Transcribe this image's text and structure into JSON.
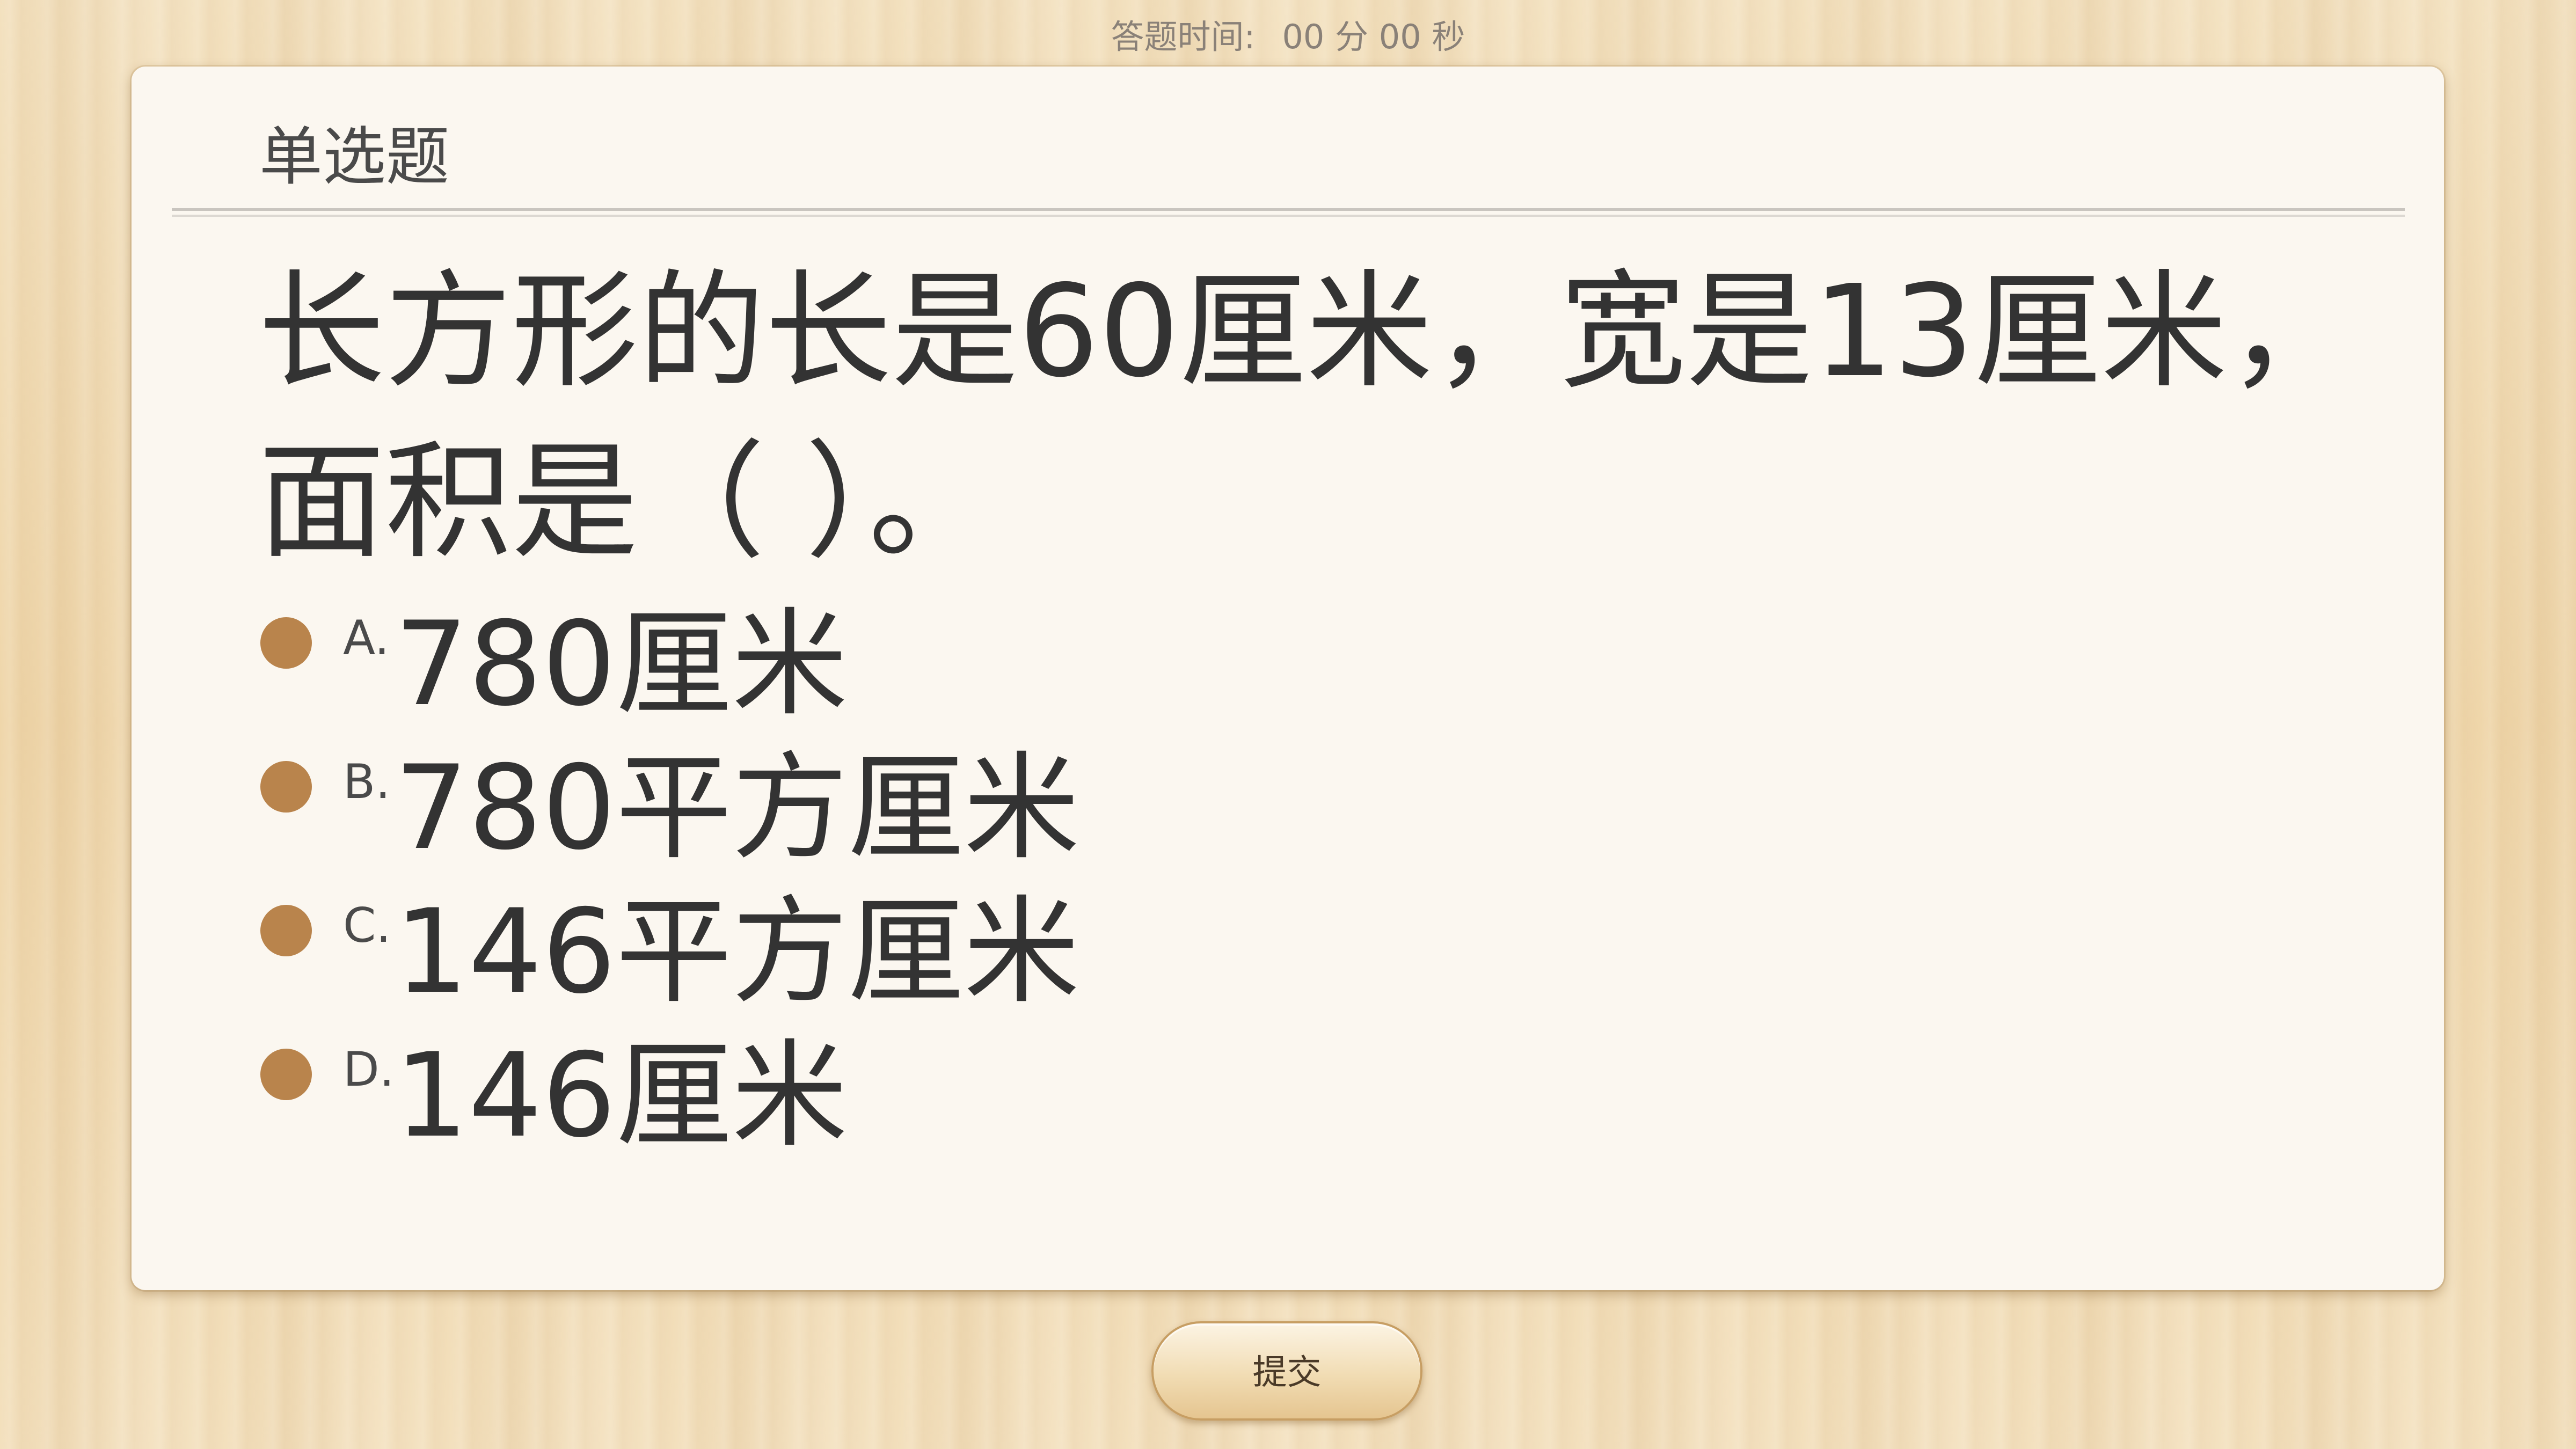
{
  "timer": {
    "label": "答题时间:",
    "minutes": "00",
    "minutes_unit": "分",
    "seconds": "00",
    "seconds_unit": "秒"
  },
  "question": {
    "type": "单选题",
    "text": "长方形的长是60厘米，宽是13厘米，面积是（    ）。",
    "options": [
      {
        "letter": "A.",
        "text": "780厘米"
      },
      {
        "letter": "B.",
        "text": "780平方厘米"
      },
      {
        "letter": "C.",
        "text": "146平方厘米"
      },
      {
        "letter": "D.",
        "text": "146厘米"
      }
    ]
  },
  "actions": {
    "submit_label": "提交"
  },
  "colors": {
    "radio": "#b9844c",
    "card_background": "#fbf7f0",
    "wood_background": "#f1dcb6"
  }
}
